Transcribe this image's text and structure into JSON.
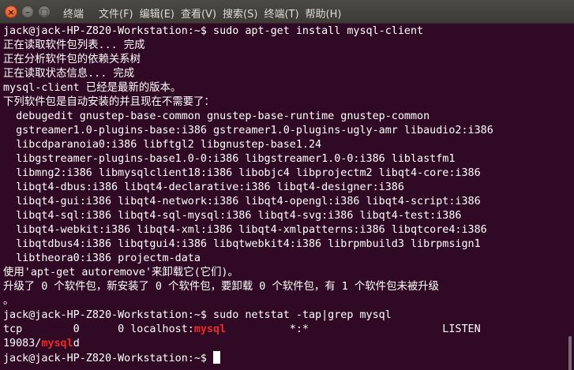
{
  "window": {
    "title": "终端",
    "menu": [
      "文件(F)",
      "编辑(E)",
      "查看(V)",
      "搜索(S)",
      "终端(T)",
      "帮助(H)"
    ],
    "close_glyph": "×",
    "minimize_glyph": "–",
    "maximize_glyph": "□"
  },
  "terminal": {
    "lines": [
      "jack@jack-HP-Z820-Workstation:~$ sudo apt-get install mysql-client",
      "正在读取软件包列表... 完成",
      "正在分析软件包的依赖关系树",
      "正在读取状态信息... 完成",
      "mysql-client 已经是最新的版本。",
      "下列软件包是自动安装的并且现在不需要了：",
      "  debugedit gnustep-base-common gnustep-base-runtime gnustep-common",
      "  gstreamer1.0-plugins-base:i386 gstreamer1.0-plugins-ugly-amr libaudio2:i386",
      "  libcdparanoia0:i386 libftgl2 libgnustep-base1.24",
      "  libgstreamer-plugins-base1.0-0:i386 libgstreamer1.0-0:i386 liblastfm1",
      "  libmng2:i386 libmysqlclient18:i386 libobjc4 libprojectm2 libqt4-core:i386",
      "  libqt4-dbus:i386 libqt4-declarative:i386 libqt4-designer:i386",
      "  libqt4-gui:i386 libqt4-network:i386 libqt4-opengl:i386 libqt4-script:i386",
      "  libqt4-sql:i386 libqt4-sql-mysql:i386 libqt4-svg:i386 libqt4-test:i386",
      "  libqt4-webkit:i386 libqt4-xml:i386 libqt4-xmlpatterns:i386 libqtcore4:i386",
      "  libqtdbus4:i386 libqtgui4:i386 libqtwebkit4:i386 librpmbuild3 librpmsign1",
      "  libtheora0:i386 projectm-data",
      "使用'apt-get autoremove'来卸载它(它们)。",
      "升级了 0 个软件包，新安装了 0 个软件包，要卸载 0 个软件包，有 1 个软件包未被升级",
      "。",
      "jack@jack-HP-Z820-Workstation:~$ sudo netstat -tap|grep mysql"
    ],
    "netstat_proto": "tcp",
    "netstat_counts": "        0      0 localhost:",
    "netstat_match": "mysql",
    "netstat_rest": "          *:*                     LISTEN",
    "pid_prefix": "19083/",
    "pid_match": "mysql",
    "pid_suffix": "d",
    "final_prompt": "jack@jack-HP-Z820-Workstation:~$ "
  },
  "colors": {
    "background": "#300a24",
    "text": "#ffffff",
    "grep_highlight": "#ef2929",
    "menubar": "#3c3b37",
    "close_button": "#e35d2d"
  }
}
